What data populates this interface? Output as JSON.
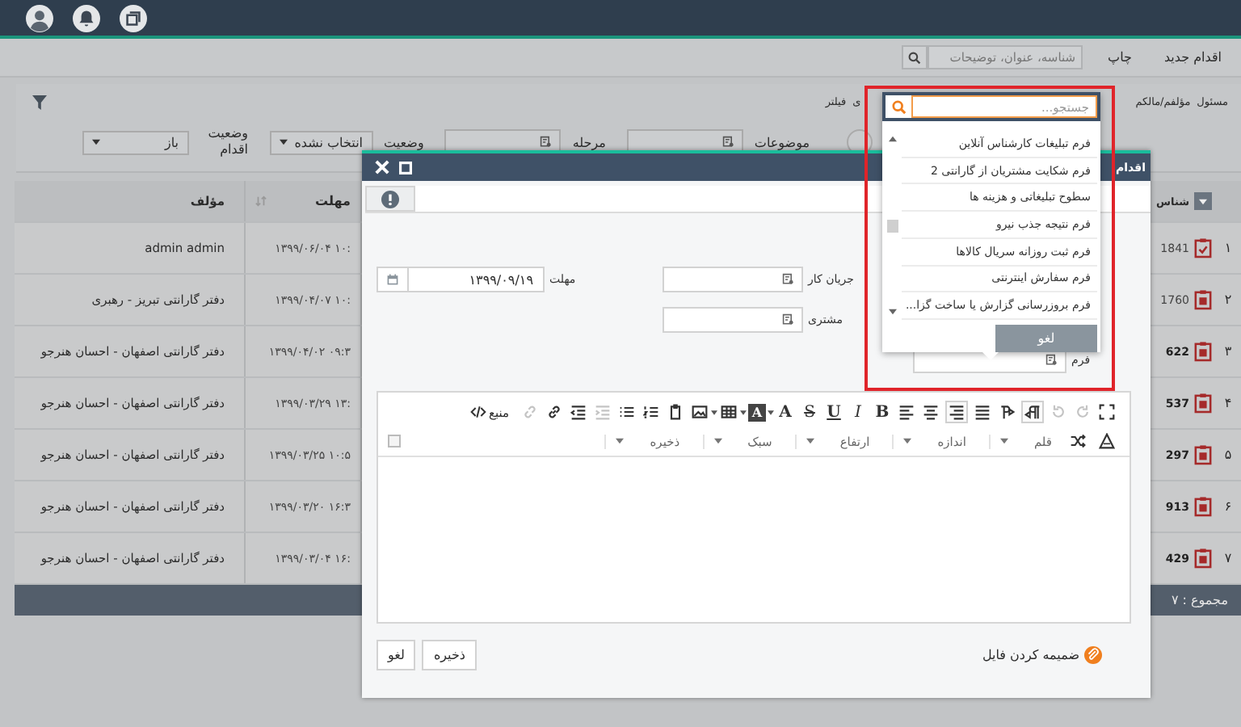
{
  "toolbar": {
    "new_action": "اقدام جدید",
    "print": "چاپ",
    "search_placeholder": "شناسه، عنوان، توضیحات"
  },
  "filter": {
    "headers": [
      "مسئول",
      "مؤلفم/مالکم",
      "ی",
      "فیلتر"
    ],
    "toggle_on": false,
    "subjects_label": "موضوعات",
    "stage_label": "مرحله",
    "stage_status_label": "وضعیت",
    "stage_status_value": "انتخاب نشده",
    "action_status_label": "وضعیت اقدام",
    "action_status_value": "باز"
  },
  "table": {
    "columns": [
      "شناس",
      "مهلت",
      "مؤلف"
    ],
    "rows": [
      {
        "index": "۱",
        "kind": "checklist",
        "id": "1841",
        "unread": false,
        "deadline": "۱۳۹۹/۰۶/۰۴ ۱۰:",
        "author": "admin admin"
      },
      {
        "index": "۲",
        "kind": "form",
        "id": "1760",
        "unread": false,
        "deadline": "۱۳۹۹/۰۴/۰۷ ۱۰:",
        "author": "دفتر گارانتی تبریز - رهبری"
      },
      {
        "index": "۳",
        "kind": "form",
        "id": "622",
        "unread": true,
        "deadline": "۱۳۹۹/۰۴/۰۲ ۰۹:۳",
        "author": "دفتر گارانتی اصفهان - احسان هنرجو"
      },
      {
        "index": "۴",
        "kind": "form",
        "id": "537",
        "unread": true,
        "deadline": "۱۳۹۹/۰۳/۲۹ ۱۳:",
        "author": "دفتر گارانتی اصفهان - احسان هنرجو"
      },
      {
        "index": "۵",
        "kind": "form",
        "id": "297",
        "unread": true,
        "deadline": "۱۳۹۹/۰۳/۲۵ ۱۰:۵",
        "author": "دفتر گارانتی اصفهان - احسان هنرجو"
      },
      {
        "index": "۶",
        "kind": "form",
        "id": "913",
        "unread": true,
        "deadline": "۱۳۹۹/۰۳/۲۰ ۱۶:۳",
        "author": "دفتر گارانتی اصفهان - احسان هنرجو"
      },
      {
        "index": "۷",
        "kind": "form",
        "id": "429",
        "unread": true,
        "deadline": "۱۳۹۹/۰۳/۰۴ ۱۶:",
        "author": "دفتر گارانتی اصفهان - احسان هنرجو"
      }
    ],
    "total": "مجموع : ۷"
  },
  "modal": {
    "title": "اقدام",
    "fields": [
      {
        "label": "جریان کار"
      },
      {
        "label": "مهلت",
        "value": "۱۳۹۹/۰۹/۱۹"
      },
      {
        "label": "مشتری"
      },
      {
        "label": "فرم"
      }
    ],
    "editor": {
      "letters": [
        "B",
        "I",
        "U",
        "S",
        "A",
        "A"
      ],
      "source": "منبع",
      "dropdowns": [
        "قلم",
        "اندازه",
        "ارتفاع",
        "سبک",
        "ذخیره"
      ]
    },
    "attach": "ضمیمه کردن فایل",
    "buttons": [
      "ذخیره",
      "لغو"
    ]
  },
  "dropdown": {
    "placeholder": "جستجو...",
    "items": [
      "فرم تبلیغات کارشناس آنلاین",
      "فرم شکایت مشتریان از گارانتی 2",
      "سطوح تبلیغاتی و هزینه ها",
      "فرم نتیجه جذب نیرو",
      "فرم ثبت روزانه سریال کالاها",
      "فرم سفارش اینترنتی",
      "فرم بروزرسانی گزارش یا ساخت گزا..."
    ],
    "cancel": "لغو"
  }
}
